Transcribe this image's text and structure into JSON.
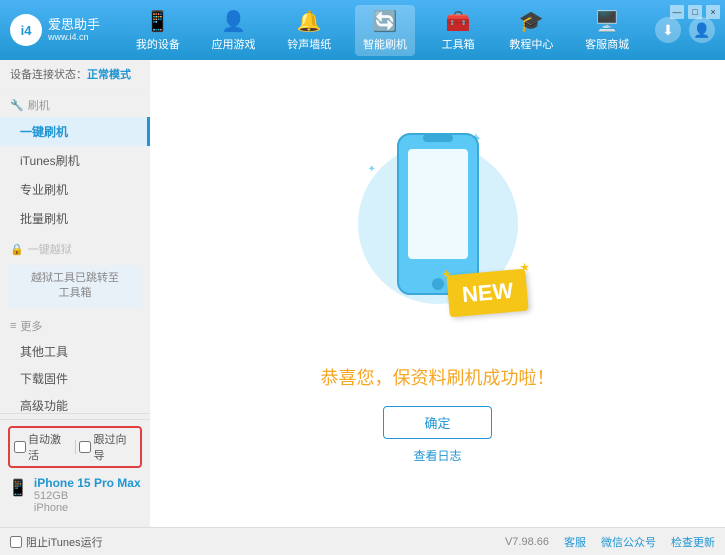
{
  "header": {
    "logo_text": "爱思助手",
    "logo_sub": "www.i4.cn",
    "logo_abbr": "i4",
    "nav_items": [
      {
        "id": "my-device",
        "label": "我的设备",
        "icon": "📱"
      },
      {
        "id": "apps-games",
        "label": "应用游戏",
        "icon": "👤"
      },
      {
        "id": "ringtones",
        "label": "铃声墙纸",
        "icon": "🔔"
      },
      {
        "id": "smart-flash",
        "label": "智能刷机",
        "icon": "🔄",
        "active": true
      },
      {
        "id": "toolbox",
        "label": "工具箱",
        "icon": "🧰"
      },
      {
        "id": "tutorial",
        "label": "教程中心",
        "icon": "🎓"
      },
      {
        "id": "service",
        "label": "客服商城",
        "icon": "🖥️"
      }
    ],
    "download_icon": "⬇",
    "user_icon": "👤"
  },
  "sidebar": {
    "status_label": "设备连接状态：",
    "status_mode": "正常模式",
    "flash_group_icon": "🔧",
    "flash_group_label": "刷机",
    "items": [
      {
        "id": "one-click-flash",
        "label": "一键刷机",
        "active": true
      },
      {
        "id": "itunes-flash",
        "label": "iTunes刷机",
        "active": false
      },
      {
        "id": "pro-flash",
        "label": "专业刷机",
        "active": false
      },
      {
        "id": "batch-flash",
        "label": "批量刷机",
        "active": false
      }
    ],
    "disabled_label": "一键越狱",
    "notice_line1": "越狱工具已跳转至",
    "notice_line2": "工具箱",
    "more_label": "更多",
    "more_items": [
      {
        "id": "other-tools",
        "label": "其他工具"
      },
      {
        "id": "download-firmware",
        "label": "下载固件"
      },
      {
        "id": "advanced",
        "label": "高级功能"
      }
    ],
    "auto_activate_label": "自动激活",
    "guided_activation_label": "跟过向导",
    "device_name": "iPhone 15 Pro Max",
    "device_storage": "512GB",
    "device_type": "iPhone"
  },
  "content": {
    "success_title": "恭喜您，保资料刷机成功啦！",
    "confirm_button": "确定",
    "log_link": "查看日志"
  },
  "bottom_bar": {
    "itunes_label": "阻止iTunes运行",
    "version": "V7.98.66",
    "links": [
      "客服",
      "微信公众号",
      "检查更新"
    ]
  },
  "colors": {
    "primary": "#2196d3",
    "accent": "#f5c518",
    "bg": "#f7f7f7",
    "active_bg": "#e0f0fb"
  }
}
